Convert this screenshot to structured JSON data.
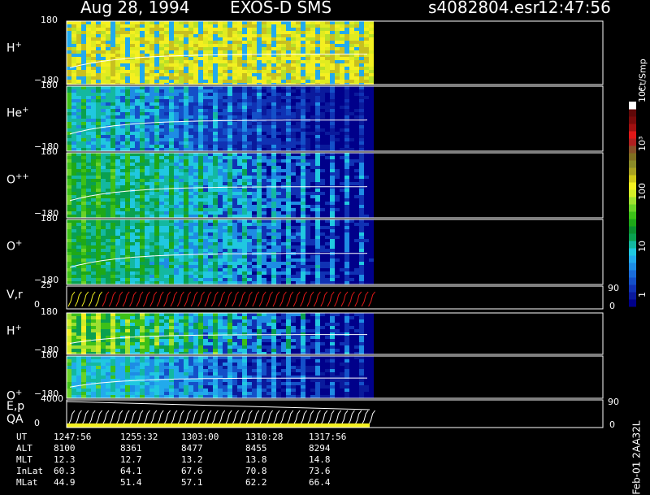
{
  "header": {
    "date": "Aug 28, 1994",
    "instrument": "EXOS-D SMS",
    "file": "s4082804.esr",
    "time": "12:47:56"
  },
  "colorbar": {
    "unit_label": "Ct/Smp",
    "tick_labels": [
      "1",
      "10",
      "100",
      "10³",
      "10⁴"
    ],
    "colors": [
      "#00008a",
      "#0a1a9c",
      "#1032b4",
      "#1450c8",
      "#1a6cd8",
      "#1e8ce4",
      "#22aaec",
      "#20c8e0",
      "#14b8a0",
      "#0aa050",
      "#0a9030",
      "#1ea818",
      "#3cc018",
      "#6ad228",
      "#9ee030",
      "#d2ec28",
      "#f4f020",
      "#d0c818",
      "#a8a020",
      "#8a8a28",
      "#806f20",
      "#885028",
      "#b02020",
      "#e01818",
      "#a01010",
      "#7a0a0a",
      "#600808",
      "#ffffff"
    ]
  },
  "panels": [
    {
      "label": "H",
      "sup": "+",
      "ytop": "180",
      "ybot": "−180",
      "kind": "spec",
      "palette": "hot"
    },
    {
      "label": "He",
      "sup": "+",
      "ytop": "180",
      "ybot": "−180",
      "kind": "spec",
      "palette": "cool"
    },
    {
      "label": "O",
      "sup": "++",
      "ytop": "180",
      "ybot": "−180",
      "kind": "spec",
      "palette": "mid"
    },
    {
      "label": "O",
      "sup": "+",
      "ytop": "180",
      "ybot": "−180",
      "kind": "spec",
      "palette": "mid"
    },
    {
      "label": "V,r",
      "sup": "",
      "ytop": "25",
      "ybot": "0",
      "kind": "line",
      "right_top": "90",
      "right_bot": "0"
    },
    {
      "label": "H",
      "sup": "+",
      "ytop": "180",
      "ybot": "−180",
      "kind": "spec",
      "palette": "cool2"
    },
    {
      "label": "O",
      "sup": "+",
      "ytop": "180",
      "ybot": "−180",
      "kind": "spec",
      "palette": "cool3"
    },
    {
      "label": "E,p",
      "label2": "QA",
      "sup": "",
      "ytop": "4000",
      "ybot": "0",
      "kind": "line2",
      "right_top": "90",
      "right_bot": "0"
    }
  ],
  "ephemeris": {
    "rows": [
      {
        "name": "UT",
        "values": [
          "1247:56",
          "1255:32",
          "1303:00",
          "1310:28",
          "1317:56"
        ]
      },
      {
        "name": "ALT",
        "values": [
          "8100",
          "8361",
          "8477",
          "8455",
          "8294"
        ]
      },
      {
        "name": "MLT",
        "values": [
          "12.3",
          "12.7",
          "13.2",
          "13.8",
          "14.8"
        ]
      },
      {
        "name": "InLat",
        "values": [
          "60.3",
          "64.1",
          "67.6",
          "70.8",
          "73.6"
        ]
      },
      {
        "name": "MLat",
        "values": [
          "44.9",
          "51.4",
          "57.1",
          "62.2",
          "66.4"
        ]
      }
    ]
  },
  "footer_vertical": "Feb-01 2AA32L",
  "chart_data": {
    "type": "heatmap",
    "title": "Aug 28, 1994   EXOS-D SMS",
    "x": [
      "1247:56",
      "1255:32",
      "1303:00",
      "1310:28",
      "1317:56"
    ],
    "panels": [
      "H+",
      "He+",
      "O++",
      "O+",
      "V,r",
      "H+",
      "O+",
      "E,p / QA"
    ],
    "ylim_spectrogram": [
      -180,
      180
    ],
    "ylim_vr": [
      0,
      25
    ],
    "ylim_ep": [
      0,
      4000
    ],
    "colorbar_unit": "Ct/Smp",
    "colorbar_range": [
      1,
      10000
    ],
    "colorbar_scale": "log"
  }
}
